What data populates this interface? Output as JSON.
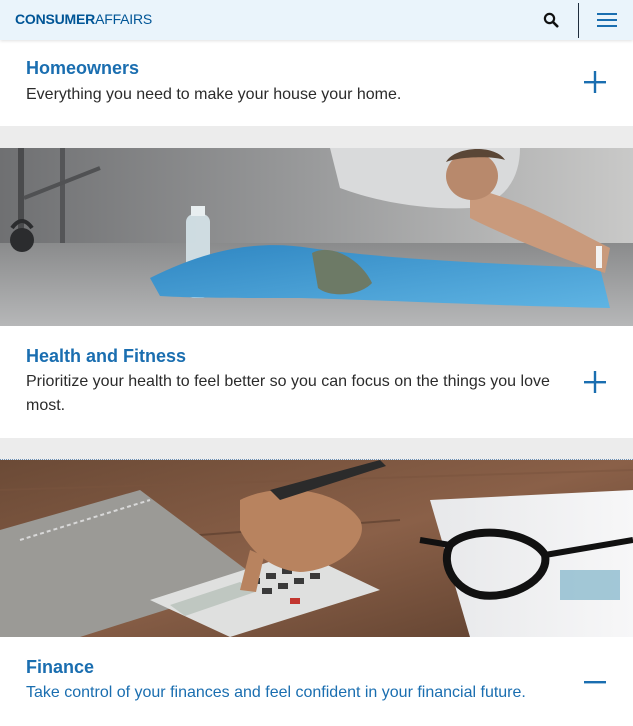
{
  "header": {
    "logo_bold": "CONSUMER",
    "logo_light": "AFFAIRS",
    "search_icon": "search-icon",
    "menu_icon": "hamburger-menu-icon"
  },
  "sections": [
    {
      "title": "Homeowners",
      "description": "Everything you need to make your house your home.",
      "state": "collapsed",
      "toggle_icon": "plus-icon"
    },
    {
      "title": "Health and Fitness",
      "description": "Prioritize your health to feel better so you can focus on the things you love most.",
      "state": "collapsed",
      "toggle_icon": "plus-icon",
      "image": "woman-stretching-photo"
    },
    {
      "title": "Finance",
      "description": "Take control of your finances and feel confident in your financial future.",
      "state": "expanded",
      "toggle_icon": "minus-icon",
      "image": "calculator-and-glasses-photo"
    }
  ],
  "colors": {
    "brand_blue": "#1a6eb0",
    "header_bg": "#eaf4fb",
    "gap_gray": "#ececec",
    "text": "#2b2b2b"
  }
}
